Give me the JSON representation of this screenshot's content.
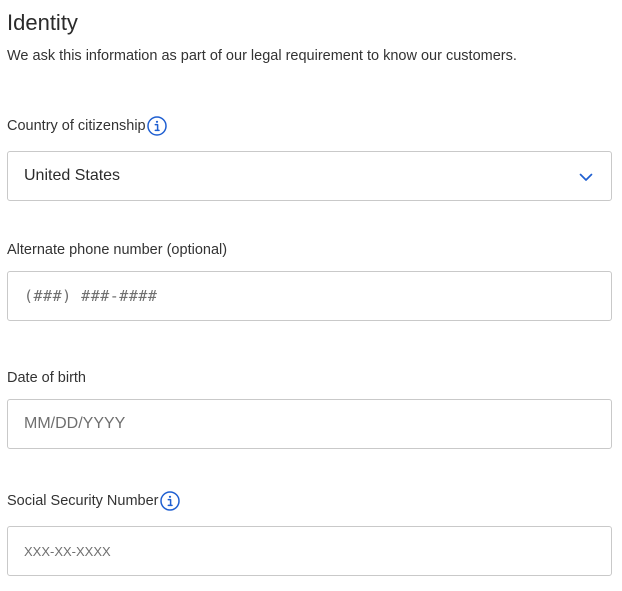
{
  "section": {
    "title": "Identity",
    "description": "We ask this information as part of our legal requirement to know our customers."
  },
  "citizenship": {
    "label": "Country of citizenship",
    "selected_value": "United States",
    "info_icon": "info-icon",
    "chevron_icon": "chevron-down-icon"
  },
  "alt_phone": {
    "label": "Alternate phone number (optional)",
    "placeholder": "(###) ###-####"
  },
  "dob": {
    "label": "Date of birth",
    "placeholder": "MM/DD/YYYY"
  },
  "ssn": {
    "label": "Social Security Number",
    "placeholder": "XXX-XX-XXXX",
    "info_icon": "info-icon"
  },
  "colors": {
    "accent": "#1f5fd1",
    "border": "#c9c9c9",
    "text": "#2b2b2b"
  }
}
